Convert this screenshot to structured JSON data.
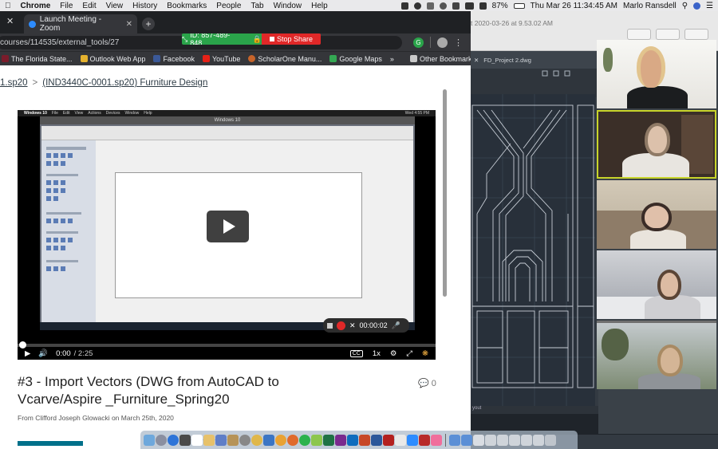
{
  "menubar": {
    "app": "Chrome",
    "menus": [
      "File",
      "Edit",
      "View",
      "History",
      "Bookmarks",
      "People",
      "Tab",
      "Window",
      "Help"
    ],
    "battery": "87%",
    "clock": "Thu Mar 26  11:34:45 AM",
    "user": "Marlo Ransdell"
  },
  "browser": {
    "tab_title": "Launch Meeting - Zoom",
    "url": "courses/114535/external_tools/27",
    "zoom_id": "ID: 857-489-848",
    "stop_share": "Stop Share",
    "bookmarks": [
      "The Florida State...",
      "Outlook Web App",
      "Facebook",
      "YouTube",
      "ScholarOne Manu...",
      "Google Maps"
    ],
    "bookmarks_more": "»",
    "other_bookmarks": "Other Bookmarks"
  },
  "page": {
    "crumb_prev": "1.sp20",
    "crumb_sep": ">",
    "crumb_current": "(IND3440C-0001.sp20) Furniture Design",
    "video_title": "#3 - Import Vectors (DWG from AutoCAD to Vcarve/Aspire _Furniture_Spring20",
    "comment_count": "0",
    "author": "From Clifford Joseph Glowacki on March 25th, 2020",
    "video": {
      "time": "0:00",
      "duration": "/ 2:25",
      "speed": "1x",
      "cc": "CC",
      "progress": 0,
      "rec_time": "00:00:02",
      "inner_window": "Windows 10",
      "inner_clock": "Wed 4:55 PM",
      "inner_menus": [
        "Windows 10",
        "File",
        "Edit",
        "View",
        "Actions",
        "Devices",
        "Window",
        "Help"
      ]
    }
  },
  "cad": {
    "title": "t 2020-03-26 at 9.53.02 AM",
    "file_tab": "FD_Project 2.dwg",
    "layout_label": "yout"
  },
  "colors": {
    "zoom_green": "#2aa44a",
    "stop_red": "#e02828",
    "active_speaker": "#c8d42a"
  }
}
